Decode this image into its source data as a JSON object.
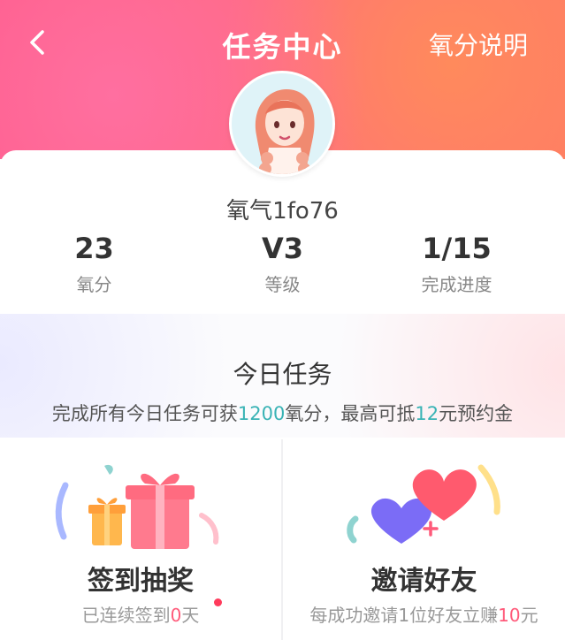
{
  "header": {
    "title": "任务中心",
    "help_link": "氧分说明",
    "back_icon": "chevron-left-icon"
  },
  "profile": {
    "nickname": "氧气1fo76",
    "stats": [
      {
        "value": "23",
        "label": "氧分"
      },
      {
        "value": "V3",
        "label": "等级"
      },
      {
        "value": "1/15",
        "label": "完成进度"
      }
    ]
  },
  "today": {
    "title": "今日任务",
    "desc_prefix": "完成所有今日任务可获",
    "points": "1200",
    "desc_mid": "氧分，最高可抵",
    "amount": "12",
    "desc_suffix": "元预约金"
  },
  "tasks": {
    "checkin": {
      "name": "签到抽奖",
      "sub_prefix": "已连续签到",
      "days": "0",
      "sub_suffix": "天",
      "icon": "gift-box-icon"
    },
    "invite": {
      "name": "邀请好友",
      "sub_prefix": "每成功邀请1位好友立赚",
      "amount": "10",
      "sub_suffix": "元",
      "icon": "hearts-icon"
    }
  },
  "colors": {
    "accent": "#39b3b5",
    "header_pink": "#ff5a8a",
    "header_orange": "#ff7a66"
  }
}
